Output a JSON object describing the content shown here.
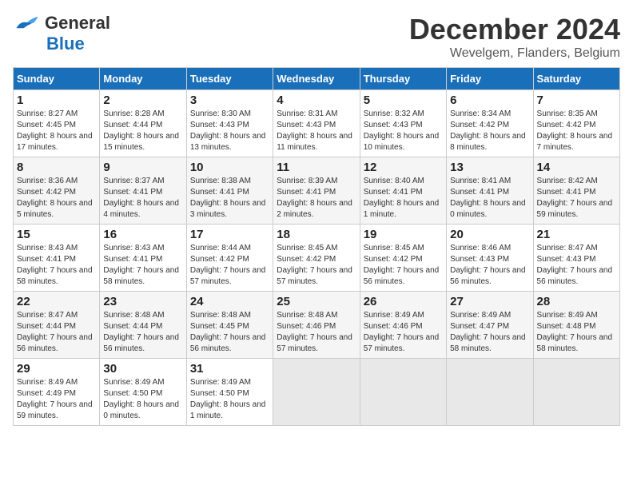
{
  "header": {
    "logo_line1": "General",
    "logo_line2": "Blue",
    "month": "December 2024",
    "location": "Wevelgem, Flanders, Belgium"
  },
  "weekdays": [
    "Sunday",
    "Monday",
    "Tuesday",
    "Wednesday",
    "Thursday",
    "Friday",
    "Saturday"
  ],
  "weeks": [
    [
      {
        "day": "1",
        "sunrise": "8:27 AM",
        "sunset": "4:45 PM",
        "daylight": "8 hours and 17 minutes."
      },
      {
        "day": "2",
        "sunrise": "8:28 AM",
        "sunset": "4:44 PM",
        "daylight": "8 hours and 15 minutes."
      },
      {
        "day": "3",
        "sunrise": "8:30 AM",
        "sunset": "4:43 PM",
        "daylight": "8 hours and 13 minutes."
      },
      {
        "day": "4",
        "sunrise": "8:31 AM",
        "sunset": "4:43 PM",
        "daylight": "8 hours and 11 minutes."
      },
      {
        "day": "5",
        "sunrise": "8:32 AM",
        "sunset": "4:43 PM",
        "daylight": "8 hours and 10 minutes."
      },
      {
        "day": "6",
        "sunrise": "8:34 AM",
        "sunset": "4:42 PM",
        "daylight": "8 hours and 8 minutes."
      },
      {
        "day": "7",
        "sunrise": "8:35 AM",
        "sunset": "4:42 PM",
        "daylight": "8 hours and 7 minutes."
      }
    ],
    [
      {
        "day": "8",
        "sunrise": "8:36 AM",
        "sunset": "4:42 PM",
        "daylight": "8 hours and 5 minutes."
      },
      {
        "day": "9",
        "sunrise": "8:37 AM",
        "sunset": "4:41 PM",
        "daylight": "8 hours and 4 minutes."
      },
      {
        "day": "10",
        "sunrise": "8:38 AM",
        "sunset": "4:41 PM",
        "daylight": "8 hours and 3 minutes."
      },
      {
        "day": "11",
        "sunrise": "8:39 AM",
        "sunset": "4:41 PM",
        "daylight": "8 hours and 2 minutes."
      },
      {
        "day": "12",
        "sunrise": "8:40 AM",
        "sunset": "4:41 PM",
        "daylight": "8 hours and 1 minute."
      },
      {
        "day": "13",
        "sunrise": "8:41 AM",
        "sunset": "4:41 PM",
        "daylight": "8 hours and 0 minutes."
      },
      {
        "day": "14",
        "sunrise": "8:42 AM",
        "sunset": "4:41 PM",
        "daylight": "7 hours and 59 minutes."
      }
    ],
    [
      {
        "day": "15",
        "sunrise": "8:43 AM",
        "sunset": "4:41 PM",
        "daylight": "7 hours and 58 minutes."
      },
      {
        "day": "16",
        "sunrise": "8:43 AM",
        "sunset": "4:41 PM",
        "daylight": "7 hours and 58 minutes."
      },
      {
        "day": "17",
        "sunrise": "8:44 AM",
        "sunset": "4:42 PM",
        "daylight": "7 hours and 57 minutes."
      },
      {
        "day": "18",
        "sunrise": "8:45 AM",
        "sunset": "4:42 PM",
        "daylight": "7 hours and 57 minutes."
      },
      {
        "day": "19",
        "sunrise": "8:45 AM",
        "sunset": "4:42 PM",
        "daylight": "7 hours and 56 minutes."
      },
      {
        "day": "20",
        "sunrise": "8:46 AM",
        "sunset": "4:43 PM",
        "daylight": "7 hours and 56 minutes."
      },
      {
        "day": "21",
        "sunrise": "8:47 AM",
        "sunset": "4:43 PM",
        "daylight": "7 hours and 56 minutes."
      }
    ],
    [
      {
        "day": "22",
        "sunrise": "8:47 AM",
        "sunset": "4:44 PM",
        "daylight": "7 hours and 56 minutes."
      },
      {
        "day": "23",
        "sunrise": "8:48 AM",
        "sunset": "4:44 PM",
        "daylight": "7 hours and 56 minutes."
      },
      {
        "day": "24",
        "sunrise": "8:48 AM",
        "sunset": "4:45 PM",
        "daylight": "7 hours and 56 minutes."
      },
      {
        "day": "25",
        "sunrise": "8:48 AM",
        "sunset": "4:46 PM",
        "daylight": "7 hours and 57 minutes."
      },
      {
        "day": "26",
        "sunrise": "8:49 AM",
        "sunset": "4:46 PM",
        "daylight": "7 hours and 57 minutes."
      },
      {
        "day": "27",
        "sunrise": "8:49 AM",
        "sunset": "4:47 PM",
        "daylight": "7 hours and 58 minutes."
      },
      {
        "day": "28",
        "sunrise": "8:49 AM",
        "sunset": "4:48 PM",
        "daylight": "7 hours and 58 minutes."
      }
    ],
    [
      {
        "day": "29",
        "sunrise": "8:49 AM",
        "sunset": "4:49 PM",
        "daylight": "7 hours and 59 minutes."
      },
      {
        "day": "30",
        "sunrise": "8:49 AM",
        "sunset": "4:50 PM",
        "daylight": "8 hours and 0 minutes."
      },
      {
        "day": "31",
        "sunrise": "8:49 AM",
        "sunset": "4:50 PM",
        "daylight": "8 hours and 1 minute."
      },
      null,
      null,
      null,
      null
    ]
  ],
  "labels": {
    "sunrise": "Sunrise:",
    "sunset": "Sunset:",
    "daylight": "Daylight:"
  }
}
